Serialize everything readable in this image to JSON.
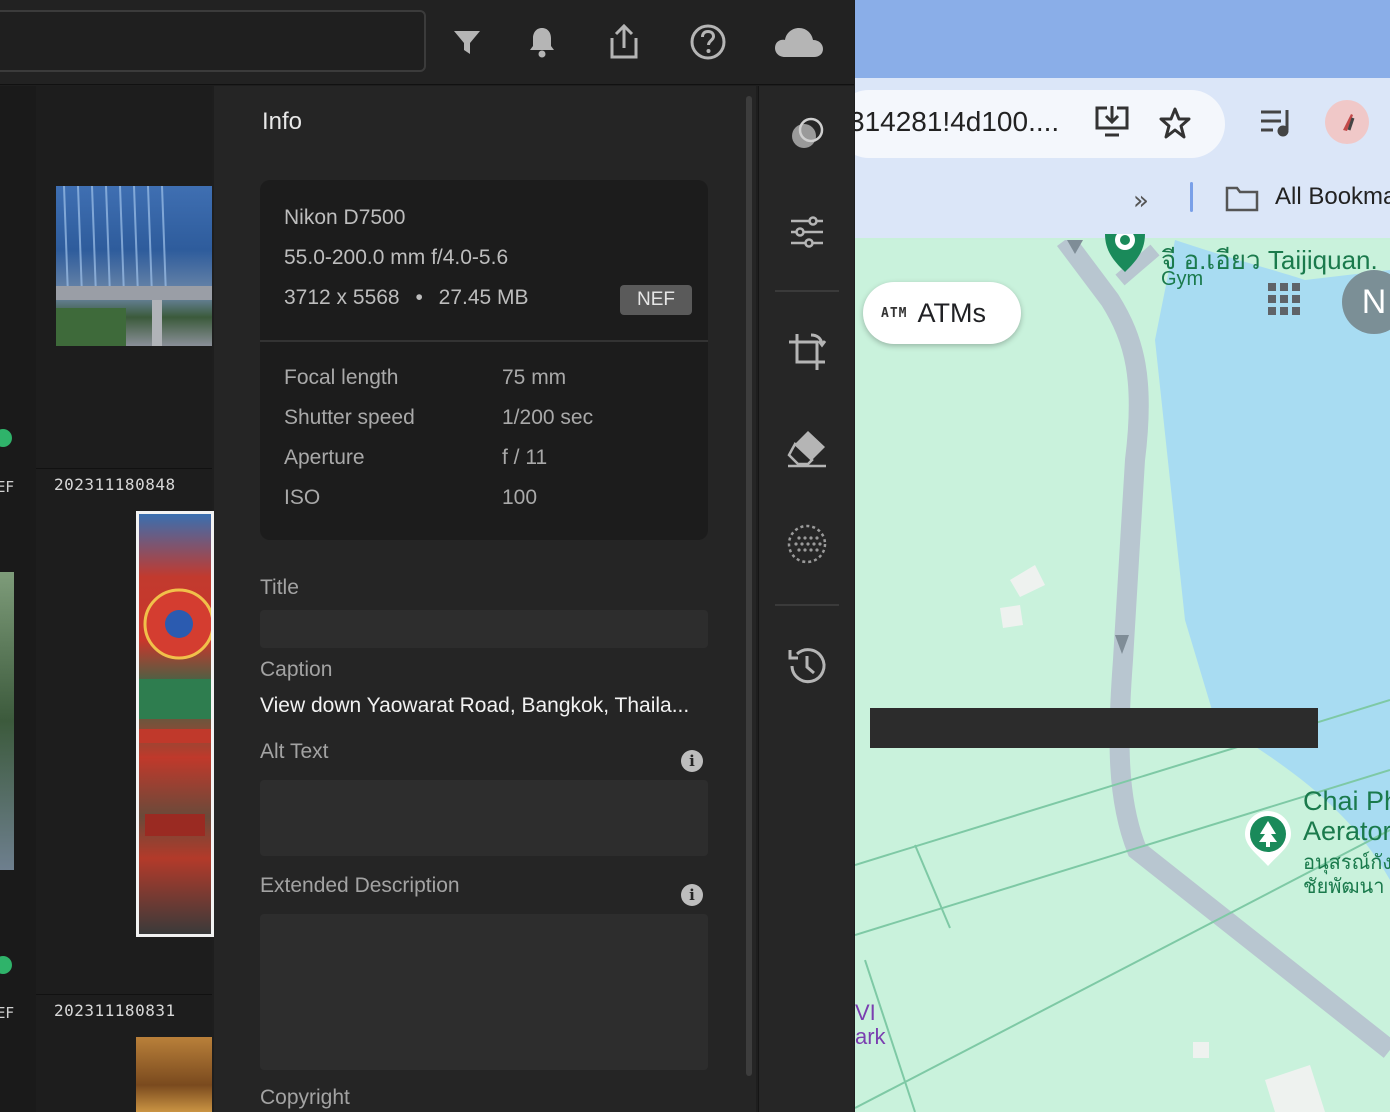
{
  "lightroom": {
    "toolbar": {
      "icons": [
        "filter-icon",
        "bell-icon",
        "share-icon",
        "help-icon",
        "cloud-icon"
      ]
    },
    "grid": {
      "tiles": [
        {
          "name": ""
        },
        {
          "name": "202311180848",
          "badge": "EF"
        },
        {
          "name": "202311180831",
          "badge": "EF"
        }
      ]
    },
    "info": {
      "title": "Info",
      "camera": "Nikon D7500",
      "lens": "55.0-200.0 mm f/4.0-5.6",
      "dimensions": "3712 x 5568",
      "separator": "•",
      "filesize": "27.45 MB",
      "format": "NEF",
      "exif": [
        {
          "label": "Focal length",
          "value": "75 mm"
        },
        {
          "label": "Shutter speed",
          "value": "1/200 sec"
        },
        {
          "label": "Aperture",
          "value": "f / 11"
        },
        {
          "label": "ISO",
          "value": "100"
        }
      ],
      "fields": {
        "title_label": "Title",
        "caption_label": "Caption",
        "caption_value": "View down Yaowarat Road, Bangkok, Thaila...",
        "alt_text_label": "Alt Text",
        "extended_description_label": "Extended Description",
        "copyright_label": "Copyright",
        "info_glyph": "i"
      }
    },
    "tools": [
      "presets-icon",
      "edit-sliders-icon",
      "crop-icon",
      "healing-eraser-icon",
      "masking-icon",
      "history-icon"
    ]
  },
  "browser": {
    "url": "314281!4d100....",
    "bookmarks_overflow": "»",
    "bookmarks_label": "All Bookma",
    "map": {
      "atm_tag": "ATM",
      "atm_label": "ATMs",
      "avatar_initial": "N",
      "place_thai": "จี อ.เอียว Taijiquan.",
      "place_type": "Gym",
      "park_line1": "Chai Ph",
      "park_line2": "Aerator",
      "park_thai1": "อนุสรณ์กัง",
      "park_thai2": "ชัยพัฒนา",
      "purple_line1": "VI",
      "purple_line2": "ark"
    }
  }
}
